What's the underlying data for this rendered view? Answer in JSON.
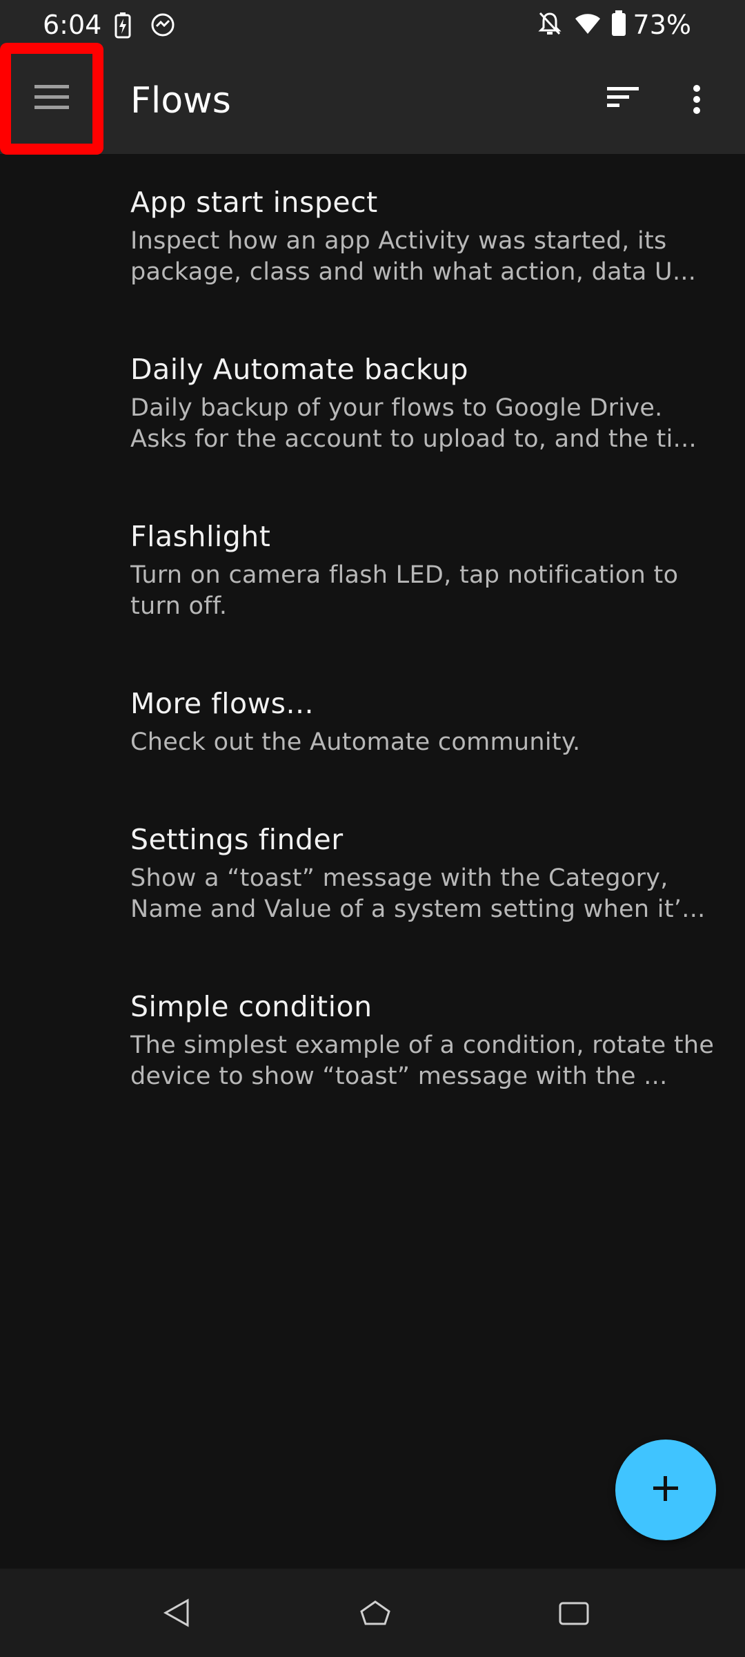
{
  "status_bar": {
    "time": "6:04",
    "battery_percent": "73%",
    "icons": [
      "battery-charging-icon",
      "sync-icon",
      "notifications-off-icon",
      "wifi-icon",
      "battery-icon"
    ]
  },
  "app_bar": {
    "title": "Flows",
    "icons": [
      "menu-icon",
      "sort-icon",
      "more-vert-icon"
    ]
  },
  "flows": [
    {
      "title": "App start inspect",
      "description": "Inspect how an app Activity was started, its package, class and with what action, data U..."
    },
    {
      "title": "Daily Automate backup",
      "description": "Daily backup of your flows to Google Drive. Asks for the account to upload to, and the ti..."
    },
    {
      "title": "Flashlight",
      "description": "Turn on camera flash LED, tap notification to turn off."
    },
    {
      "title": "More flows...",
      "description": "Check out the Automate community."
    },
    {
      "title": "Settings finder",
      "description": "Show a “toast” message with the Category, Name and Value of a system setting when it’..."
    },
    {
      "title": "Simple condition",
      "description": "The simplest example of a condition, rotate the device to show “toast” message with the ..."
    }
  ],
  "fab": {
    "icon": "add-icon"
  },
  "nav_bar": {
    "icons": [
      "back-icon",
      "home-icon",
      "recents-icon"
    ]
  },
  "colors": {
    "background": "#121212",
    "app_bar": "#262626",
    "accent": "#40c4ff",
    "highlight": "#ff0000",
    "secondary_text": "#b8b8b8"
  }
}
